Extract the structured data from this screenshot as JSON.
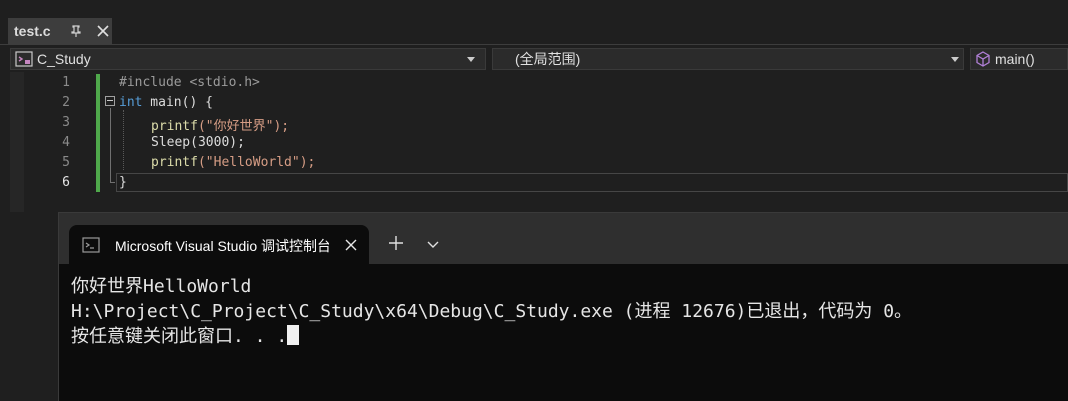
{
  "tabstrip": {
    "active_tab": "test.c"
  },
  "navbar": {
    "project": "C_Study",
    "scope": "(全局范围)",
    "member": "main()"
  },
  "editor": {
    "line_numbers": [
      "1",
      "2",
      "3",
      "4",
      "5",
      "6"
    ],
    "lines": {
      "l1": "#include <stdio.h>",
      "l2_kw": "int",
      "l2_rest": " main() {",
      "l3_fn": "printf",
      "l3_str": "(\"你好世界\");",
      "l4": "Sleep(3000);",
      "l5_fn": "printf",
      "l5_str": "(\"HelloWorld\");",
      "l6": "}"
    }
  },
  "console": {
    "tab_title": "Microsoft Visual Studio 调试控制台",
    "output": [
      "你好世界HelloWorld",
      "H:\\Project\\C_Project\\C_Study\\x64\\Debug\\C_Study.exe (进程 12676)已退出，代码为 0。",
      "按任意键关闭此窗口. . ."
    ]
  },
  "colors": {
    "keyword": "#569cd6",
    "string": "#d69d85",
    "function": "#dcdcaa",
    "change_bar": "#4fa84b"
  },
  "icons": [
    "pin-icon",
    "close-icon",
    "project-icon",
    "dropdown-arrow-icon",
    "cube-icon",
    "terminal-icon",
    "plus-icon",
    "chevron-down-icon"
  ]
}
